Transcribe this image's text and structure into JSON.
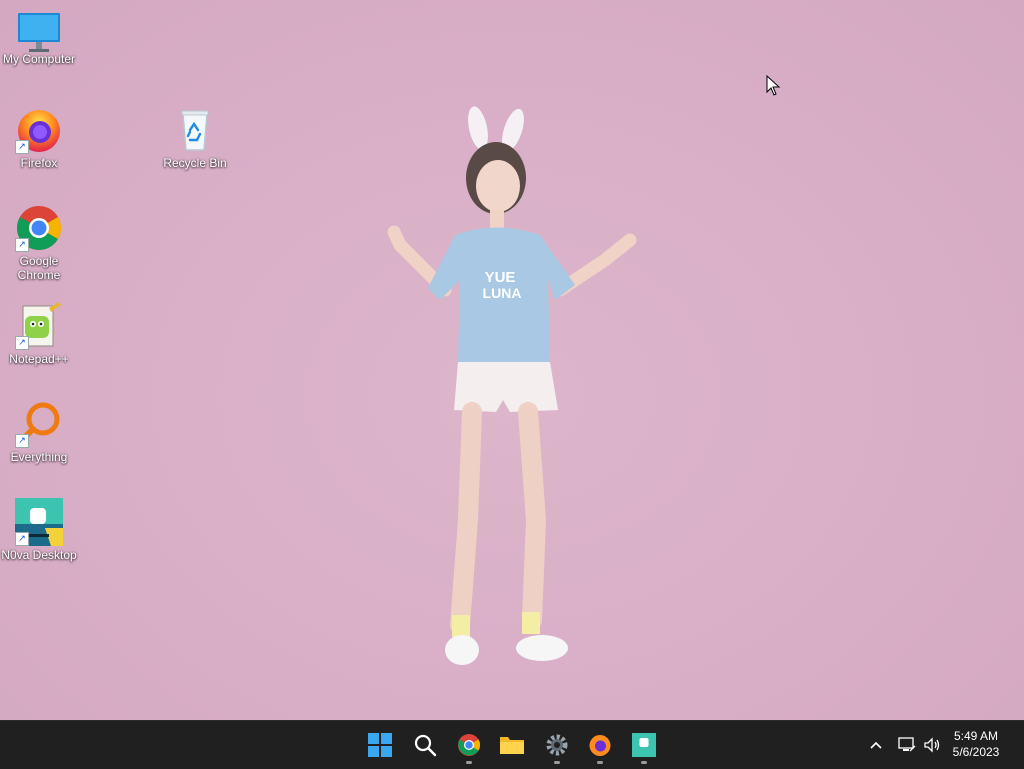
{
  "desktop": {
    "icons": [
      {
        "label": "My Computer",
        "icon": "monitor-icon"
      },
      {
        "label": "Firefox",
        "icon": "firefox-icon"
      },
      {
        "label": "Recycle Bin",
        "icon": "recycle-bin-icon"
      },
      {
        "label": "Google Chrome",
        "icon": "chrome-icon"
      },
      {
        "label": "Notepad++",
        "icon": "notepadpp-icon"
      },
      {
        "label": "Everything",
        "icon": "everything-icon"
      },
      {
        "label": "N0va Desktop",
        "icon": "nova-desktop-icon"
      }
    ],
    "wallpaper": {
      "background": "#dcb3c9"
    }
  },
  "taskbar": {
    "apps": [
      {
        "name": "start-button",
        "icon": "windows-logo-icon"
      },
      {
        "name": "search-button",
        "icon": "search-icon"
      },
      {
        "name": "chrome",
        "icon": "chrome-icon"
      },
      {
        "name": "file-explorer",
        "icon": "folder-icon"
      },
      {
        "name": "settings",
        "icon": "gear-icon"
      },
      {
        "name": "firefox",
        "icon": "firefox-icon"
      },
      {
        "name": "nova-desktop",
        "icon": "nova-desktop-icon"
      }
    ],
    "clock": {
      "time": "5:49 AM",
      "date": "5/6/2023"
    },
    "accent": "#202020"
  }
}
